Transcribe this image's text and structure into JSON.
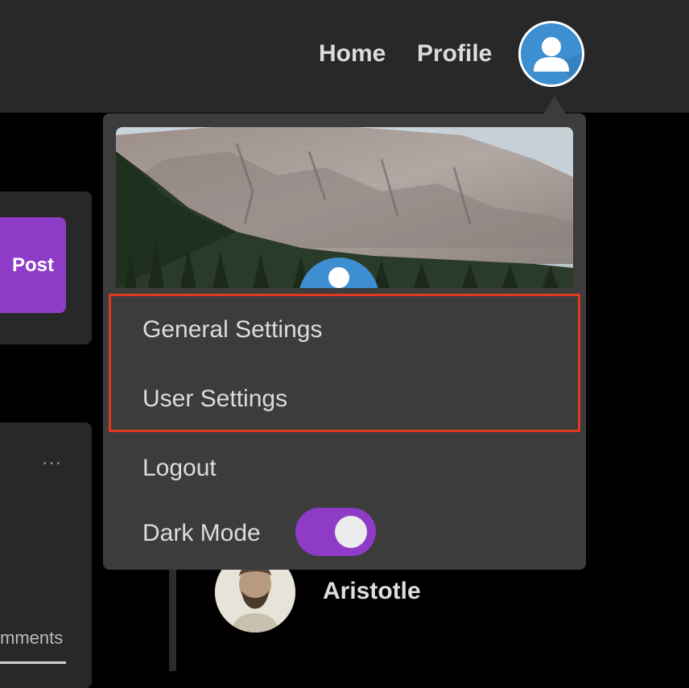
{
  "header": {
    "nav": [
      {
        "label": "Home"
      },
      {
        "label": "Profile"
      }
    ],
    "avatar_icon": "user-avatar-icon"
  },
  "composer": {
    "post_label": "Post"
  },
  "feed": {
    "more_icon": "···",
    "comments_tab_label": "mments"
  },
  "dropdown": {
    "cover_image": "mountain-forest-cover",
    "items": [
      {
        "label": "General Settings"
      },
      {
        "label": "User Settings"
      },
      {
        "label": "Logout"
      }
    ],
    "dark_mode": {
      "label": "Dark Mode",
      "enabled": true
    },
    "highlight_color": "#e03a1e"
  },
  "profile_entry": {
    "name": "Aristotle"
  },
  "colors": {
    "accent_purple": "#8e3cc8",
    "avatar_blue": "#3d8fd1",
    "topbar": "#282828",
    "menu_bg": "#3c3c3c"
  }
}
